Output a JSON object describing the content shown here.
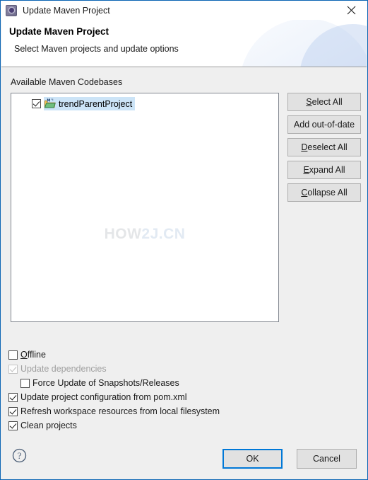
{
  "window": {
    "title": "Update Maven Project",
    "icon": "maven-gear-icon",
    "close_label": "×"
  },
  "header": {
    "title": "Update Maven Project",
    "subtitle": "Select Maven projects and update options"
  },
  "tree": {
    "group_label": "Available Maven Codebases",
    "items": [
      {
        "label": "trendParentProject",
        "checked": true,
        "selected": true,
        "icon": "maven-project-folder-icon"
      }
    ],
    "watermark": {
      "part1": "HOW",
      "part2": "2J.CN"
    }
  },
  "side_buttons": [
    {
      "label": "Select All",
      "mnemonic": "S"
    },
    {
      "label": "Add out-of-date",
      "mnemonic": ""
    },
    {
      "label": "Deselect All",
      "mnemonic": "D"
    },
    {
      "label": "Expand All",
      "mnemonic": "E"
    },
    {
      "label": "Collapse All",
      "mnemonic": "C"
    }
  ],
  "options": [
    {
      "label": "Offline",
      "checked": false,
      "enabled": true,
      "indent": false,
      "mnemonic": "O"
    },
    {
      "label": "Update dependencies",
      "checked": true,
      "enabled": false,
      "indent": false,
      "mnemonic": ""
    },
    {
      "label": "Force Update of Snapshots/Releases",
      "checked": false,
      "enabled": true,
      "indent": true,
      "mnemonic": ""
    },
    {
      "label": "Update project configuration from pom.xml",
      "checked": true,
      "enabled": true,
      "indent": false,
      "mnemonic": ""
    },
    {
      "label": "Refresh workspace resources from local filesystem",
      "checked": true,
      "enabled": true,
      "indent": false,
      "mnemonic": ""
    },
    {
      "label": "Clean projects",
      "checked": true,
      "enabled": true,
      "indent": false,
      "mnemonic": ""
    }
  ],
  "footer": {
    "help_icon": "help-question-icon",
    "ok_label": "OK",
    "cancel_label": "Cancel"
  },
  "colors": {
    "accent": "#0078d7",
    "dialog_border": "#0a64b4",
    "background": "#efefef",
    "selection": "#cce4f7",
    "disabled_text": "#a0a0a0"
  }
}
